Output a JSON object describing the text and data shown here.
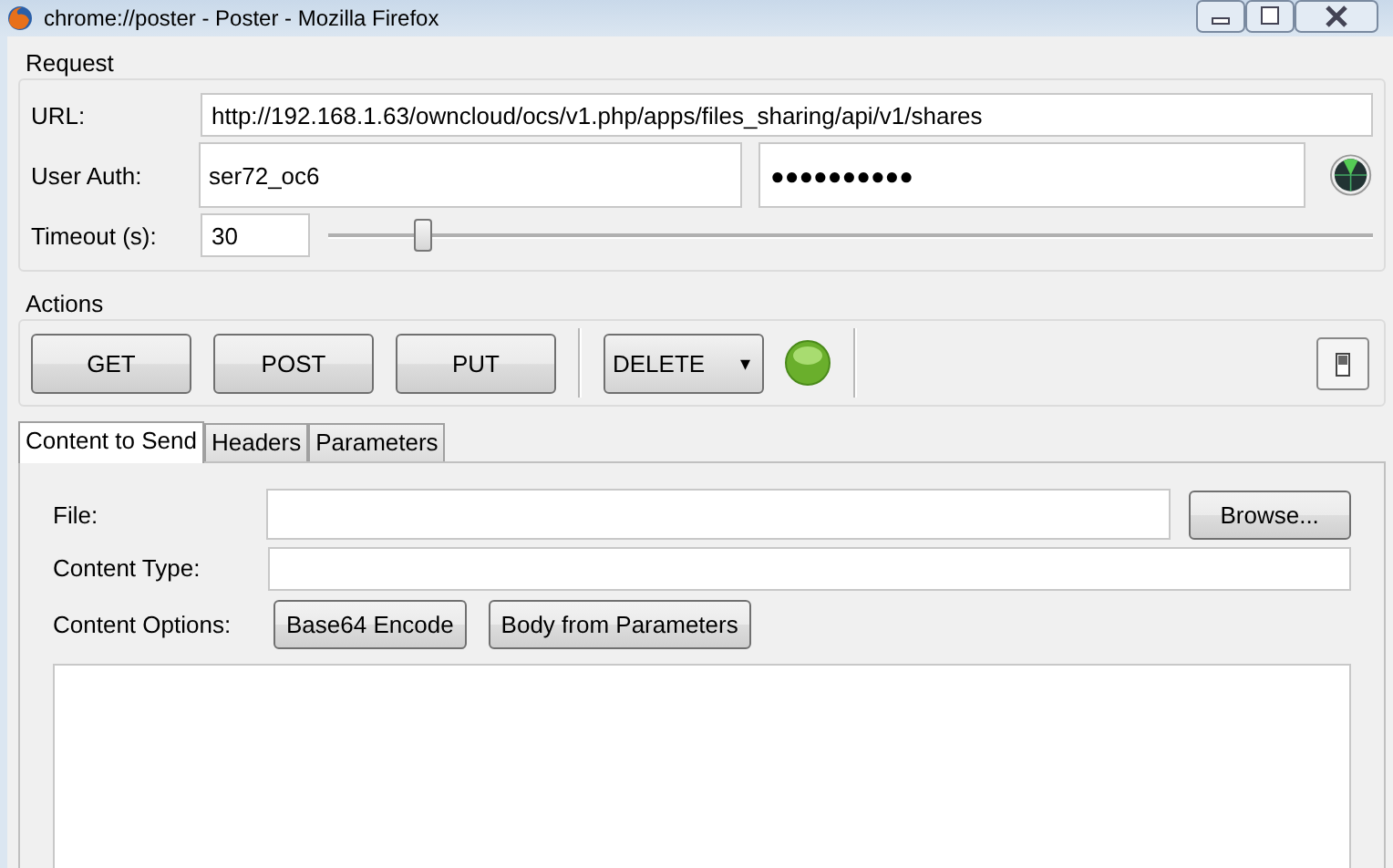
{
  "window": {
    "title": "chrome://poster - Poster - Mozilla Firefox"
  },
  "request": {
    "legend": "Request",
    "url": {
      "label": "URL:",
      "value": "http://192.168.1.63/owncloud/ocs/v1.php/apps/files_sharing/api/v1/shares"
    },
    "auth": {
      "label": "User Auth:",
      "user": "ser72_oc6",
      "password": "●●●●●●●●●●"
    },
    "timeout": {
      "label": "Timeout (s):",
      "value": "30",
      "level": 0.09
    }
  },
  "actions": {
    "legend": "Actions",
    "buttons": [
      "GET",
      "POST",
      "PUT"
    ],
    "method": {
      "value": "DELETE",
      "caret": "▾"
    }
  },
  "tabs": [
    {
      "label": "Content to Send",
      "selected": true
    },
    {
      "label": "Headers",
      "selected": false
    },
    {
      "label": "Parameters",
      "selected": false
    }
  ],
  "content": {
    "file_label": "File:",
    "browse": "Browse...",
    "type_label": "Content Type:",
    "options_label": "Content Options:",
    "option_buttons": [
      "Base64 Encode",
      "Body from Parameters"
    ]
  }
}
